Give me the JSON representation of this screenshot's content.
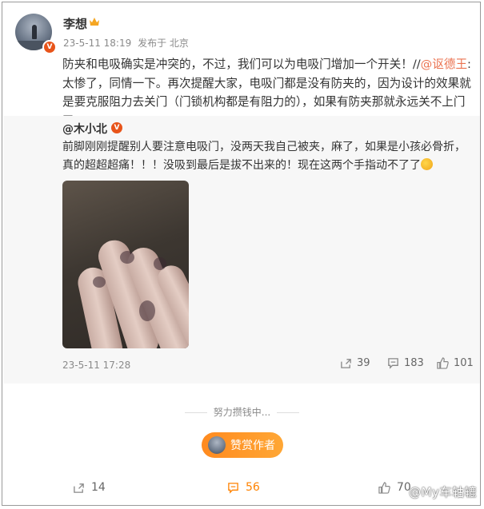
{
  "author": {
    "name": "李想",
    "verified_badge": "V",
    "post_date": "23-5-11 18:19",
    "post_source": "发布于 北京"
  },
  "post": {
    "text_before_mention": "防夹和电吸确实是冲突的，不过，我们可以为电吸门增加一个开关！//",
    "mention": "@讴德王",
    "text_after_mention": ":太惨了，同情一下。再次提醒大家，电吸门都是没有防夹的，因为设计的效果就是要克服阻力去关门（门锁机构都是有阻力的），如果有防夹那就永远关不上门了。"
  },
  "retweet": {
    "user": "@木小北",
    "verified_badge": "V",
    "text": "前脚刚刚提醒别人要注意电吸门，没两天我自己被夹，麻了，如果是小孩必骨折，真的超超超痛！！！没吸到最后是拔不出来的！现在这两个手指动不了了",
    "time": "23-5-11 17:28",
    "shares": "39",
    "comments": "183",
    "likes": "101"
  },
  "footer": {
    "divider_text": "努力攒钱中...",
    "reward_label": "赞赏作者",
    "shares": "14",
    "comments": "56",
    "likes": "70"
  },
  "watermark": "@My车轱辘",
  "colors": {
    "accent_orange": "#ff8200",
    "mention": "#eb7350",
    "badge": "#e8541a"
  }
}
